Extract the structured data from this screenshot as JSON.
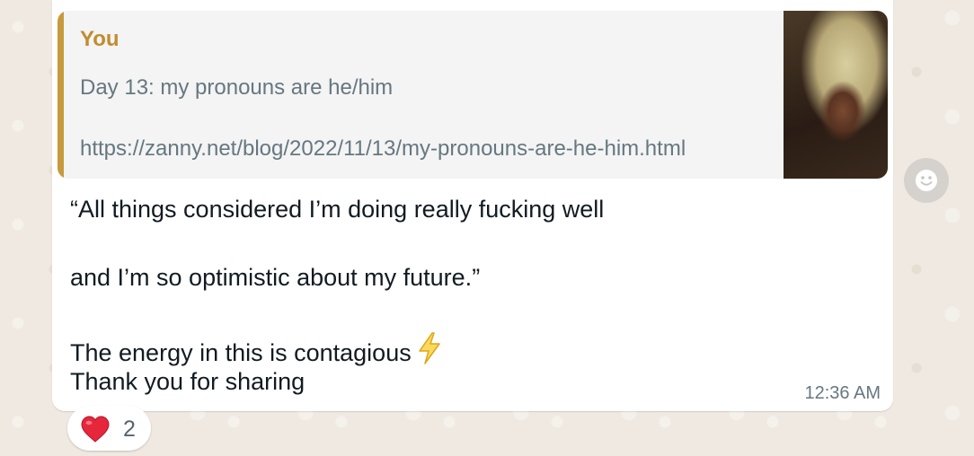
{
  "message": {
    "quote": {
      "author": "You",
      "lines": [
        "Day 13: my pronouns are he/him",
        "https://zanny.net/blog/2022/11/13/my-pronouns-are-he-him.html"
      ]
    },
    "body_lines": [
      "“All things considered I’m doing really fucking well",
      "and I’m so optimistic about my future.”",
      "The energy in this is contagious",
      "Thank you for sharing"
    ],
    "trailing_emoji": "lightning-icon",
    "timestamp": "12:36 AM"
  },
  "reaction": {
    "emoji": "heart-icon",
    "count": "2"
  },
  "colors": {
    "quote_accent": "#c89a3e",
    "quote_author": "#c18c30",
    "background": "#efeae2"
  }
}
